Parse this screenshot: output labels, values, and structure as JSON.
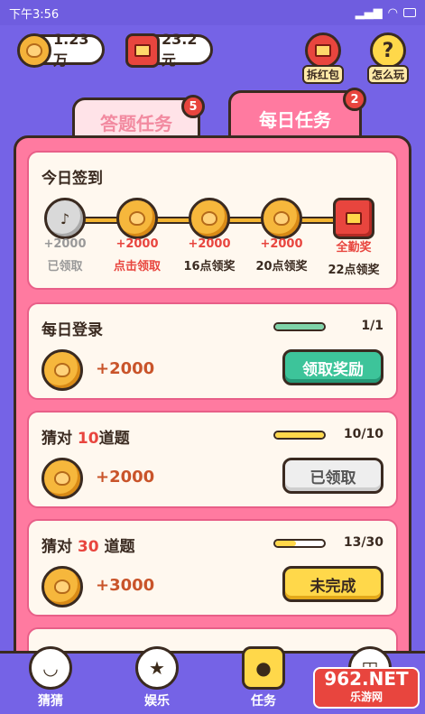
{
  "status": {
    "time": "下午3:56"
  },
  "currency": {
    "coins": "1.23万",
    "cash": "23.2元"
  },
  "top_buttons": {
    "red_packet": "拆红包",
    "how_to_play": "怎么玩",
    "how_icon": "?"
  },
  "tabs": [
    {
      "label": "答题任务",
      "badge": "5"
    },
    {
      "label": "每日任务",
      "badge": "2"
    }
  ],
  "checkin": {
    "title": "今日签到",
    "items": [
      {
        "amount": "+2000",
        "label": "已领取"
      },
      {
        "amount": "+2000",
        "label": "点击领取"
      },
      {
        "amount": "+2000",
        "label": "16点领奖"
      },
      {
        "amount": "+2000",
        "label": "20点领奖"
      },
      {
        "amount": "全勤奖",
        "label": "22点领奖"
      }
    ]
  },
  "tasks": [
    {
      "title_pre": "每日登录",
      "title_num": "",
      "title_post": "",
      "reward": "+2000",
      "progress_text": "1/1",
      "progress": 1.0,
      "button": "领取奖励"
    },
    {
      "title_pre": "猜对 ",
      "title_num": "10",
      "title_post": "道题",
      "reward": "+2000",
      "progress_text": "10/10",
      "progress": 1.0,
      "button": "已领取"
    },
    {
      "title_pre": "猜对 ",
      "title_num": "30",
      "title_post": " 道题",
      "reward": "+3000",
      "progress_text": "13/30",
      "progress": 0.43,
      "button": "未完成"
    }
  ],
  "nav": [
    {
      "label": "猜猜"
    },
    {
      "label": "娱乐"
    },
    {
      "label": "任务"
    },
    {
      "label": ""
    }
  ],
  "watermark": {
    "main": "962.NET",
    "sub": "乐游网"
  },
  "colors": {
    "background": "#7563e6",
    "panel": "#ff7aa0",
    "accent_red": "#e8453e",
    "coin": "#f6b73c",
    "green_button": "#3dc49a",
    "yellow_button": "#ffd84a"
  }
}
